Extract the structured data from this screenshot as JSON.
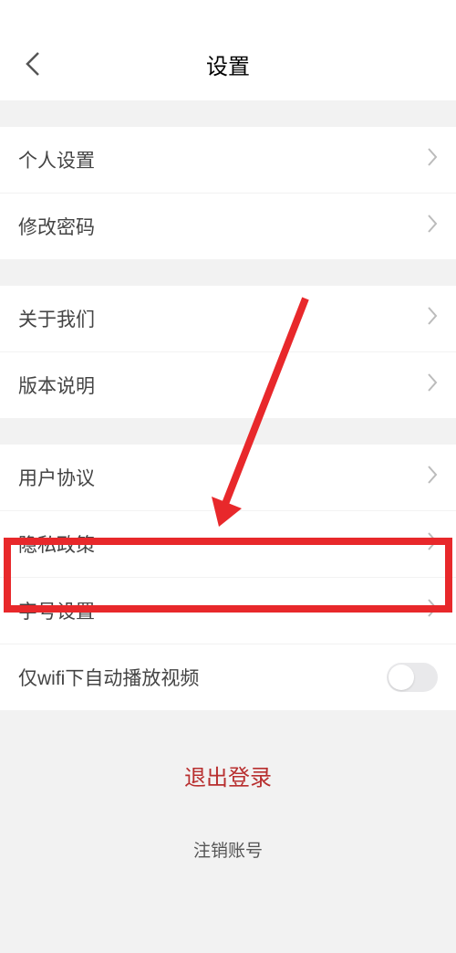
{
  "header": {
    "title": "设置"
  },
  "items": {
    "personal": "个人设置",
    "changePassword": "修改密码",
    "about": "关于我们",
    "version": "版本说明",
    "userAgreement": "用户协议",
    "privacy": "隐私政策",
    "fontSize": "字号设置",
    "wifiAutoplay": "仅wifi下自动播放视频"
  },
  "actions": {
    "logout": "退出登录",
    "deleteAccount": "注销账号"
  }
}
